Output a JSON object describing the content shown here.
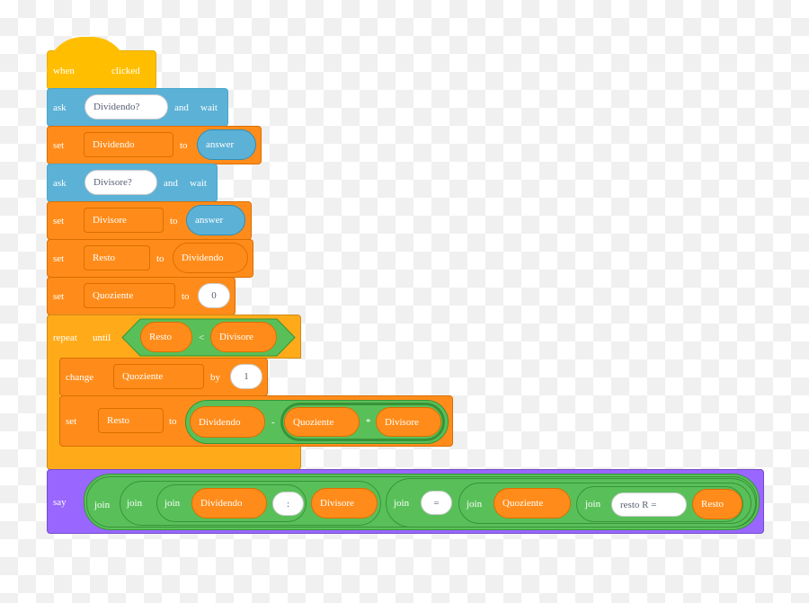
{
  "colors": {
    "events": "#FFBF00",
    "sensing": "#5CB1D6",
    "variables": "#FF8C1A",
    "control": "#FFAB19",
    "operators": "#59C059",
    "looks": "#9966FF"
  },
  "hat": {
    "when": "when",
    "clicked": "clicked"
  },
  "ask1": {
    "ask": "ask",
    "value": "Dividendo?",
    "and": "and",
    "wait": "wait"
  },
  "set1": {
    "set": "set",
    "var": "Dividendo",
    "to": "to",
    "value": "answer"
  },
  "ask2": {
    "ask": "ask",
    "value": "Divisore?",
    "and": "and",
    "wait": "wait"
  },
  "set2": {
    "set": "set",
    "var": "Divisore",
    "to": "to",
    "value": "answer"
  },
  "set3": {
    "set": "set",
    "var": "Resto",
    "to": "to",
    "value": "Dividendo"
  },
  "set4": {
    "set": "set",
    "var": "Quoziente",
    "to": "to",
    "value": "0"
  },
  "repeat": {
    "repeat": "repeat",
    "until": "until",
    "left": "Resto",
    "op": "<",
    "right": "Divisore"
  },
  "change": {
    "change": "change",
    "var": "Quoziente",
    "by": "by",
    "value": "1"
  },
  "set5": {
    "set": "set",
    "var": "Resto",
    "to": "to",
    "a": "Dividendo",
    "minus": "-",
    "b": "Quoziente",
    "times": "*",
    "c": "Divisore"
  },
  "say": {
    "say": "say",
    "join": "join",
    "v1": "Dividendo",
    "s1": ":",
    "v2": "Divisore",
    "s2": "=",
    "v3": "Quoziente",
    "s3": "resto R =",
    "v4": "Resto"
  }
}
